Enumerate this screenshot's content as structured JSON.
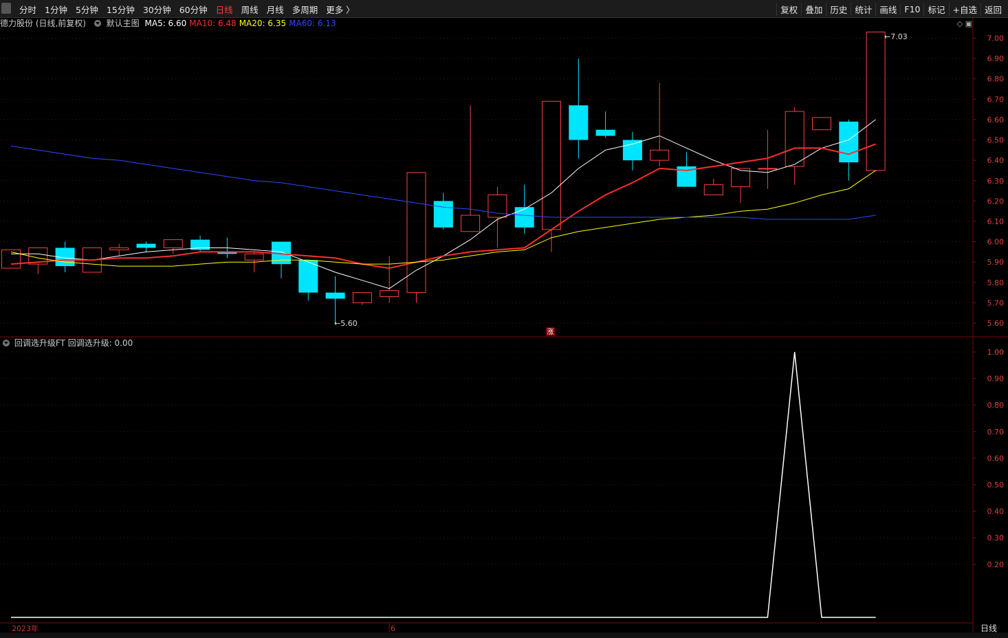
{
  "toolbar": {
    "periods": [
      "分时",
      "1分钟",
      "5分钟",
      "15分钟",
      "30分钟",
      "60分钟",
      "日线",
      "周线",
      "月线",
      "多周期",
      "更多 〉"
    ],
    "active_period": "日线",
    "right_tools": [
      "复权",
      "叠加",
      "历史",
      "统计",
      "画线",
      "F10",
      "标记",
      "+自选",
      "返回"
    ]
  },
  "main_panel": {
    "stock_label": "德力股份 (日线,前复权)",
    "template": "默认主图",
    "ma_labels": [
      {
        "text": "MA5: 6.60",
        "color": "#ffffff"
      },
      {
        "text": "MA10: 6.48",
        "color": "#ff2d2d"
      },
      {
        "text": "MA20: 6.35",
        "color": "#ffff00"
      },
      {
        "text": "MA60: 6.13",
        "color": "#2b4bff"
      }
    ],
    "high_marker": "7.03",
    "low_marker": "5.60",
    "zhang_icon": "涨"
  },
  "indicator_panel": {
    "title": "回调选升级FT",
    "value_label": "回调选升级: 0.00"
  },
  "time_axis": {
    "year_label": "2023年",
    "month_label": "6",
    "period_label": "日线"
  },
  "chart_data": [
    {
      "type": "candlestick",
      "title": "德力股份 (日线,前复权)",
      "ylim": [
        5.55,
        7.05
      ],
      "y_ticks": [
        "7.00",
        "6.90",
        "6.80",
        "6.70",
        "6.60",
        "6.50",
        "6.40",
        "6.30",
        "6.20",
        "6.10",
        "6.00",
        "5.90",
        "5.80",
        "5.70",
        "5.60"
      ],
      "candles": [
        {
          "o": 5.87,
          "h": 5.96,
          "l": 5.87,
          "c": 5.96
        },
        {
          "o": 5.89,
          "h": 5.97,
          "l": 5.84,
          "c": 5.97
        },
        {
          "o": 5.97,
          "h": 6.0,
          "l": 5.85,
          "c": 5.88
        },
        {
          "o": 5.85,
          "h": 5.97,
          "l": 5.85,
          "c": 5.97
        },
        {
          "o": 5.96,
          "h": 5.99,
          "l": 5.93,
          "c": 5.97
        },
        {
          "o": 5.99,
          "h": 6.0,
          "l": 5.95,
          "c": 5.97
        },
        {
          "o": 5.97,
          "h": 6.01,
          "l": 5.94,
          "c": 6.01
        },
        {
          "o": 6.01,
          "h": 6.03,
          "l": 5.95,
          "c": 5.96
        },
        {
          "o": 5.95,
          "h": 6.02,
          "l": 5.92,
          "c": 5.94
        },
        {
          "o": 5.91,
          "h": 5.95,
          "l": 5.85,
          "c": 5.94
        },
        {
          "o": 6.0,
          "h": 6.0,
          "l": 5.82,
          "c": 5.89
        },
        {
          "o": 5.91,
          "h": 5.91,
          "l": 5.71,
          "c": 5.75
        },
        {
          "o": 5.75,
          "h": 5.83,
          "l": 5.6,
          "c": 5.72
        },
        {
          "o": 5.7,
          "h": 5.75,
          "l": 5.69,
          "c": 5.75
        },
        {
          "o": 5.73,
          "h": 5.93,
          "l": 5.7,
          "c": 5.76
        },
        {
          "o": 5.75,
          "h": 6.34,
          "l": 5.7,
          "c": 6.34
        },
        {
          "o": 6.2,
          "h": 6.24,
          "l": 6.06,
          "c": 6.07
        },
        {
          "o": 6.05,
          "h": 6.67,
          "l": 6.05,
          "c": 6.13
        },
        {
          "o": 6.12,
          "h": 6.27,
          "l": 5.97,
          "c": 6.23
        },
        {
          "o": 6.17,
          "h": 6.28,
          "l": 6.04,
          "c": 6.07
        },
        {
          "o": 6.06,
          "h": 6.69,
          "l": 5.95,
          "c": 6.69
        },
        {
          "o": 6.67,
          "h": 6.9,
          "l": 6.41,
          "c": 6.5
        },
        {
          "o": 6.55,
          "h": 6.64,
          "l": 6.51,
          "c": 6.52
        },
        {
          "o": 6.5,
          "h": 6.54,
          "l": 6.35,
          "c": 6.4
        },
        {
          "o": 6.4,
          "h": 6.78,
          "l": 6.37,
          "c": 6.45
        },
        {
          "o": 6.37,
          "h": 6.44,
          "l": 6.27,
          "c": 6.27
        },
        {
          "o": 6.23,
          "h": 6.31,
          "l": 6.23,
          "c": 6.28
        },
        {
          "o": 6.27,
          "h": 6.36,
          "l": 6.19,
          "c": 6.36
        },
        {
          "o": 6.36,
          "h": 6.55,
          "l": 6.26,
          "c": 6.36
        },
        {
          "o": 6.37,
          "h": 6.66,
          "l": 6.28,
          "c": 6.64
        },
        {
          "o": 6.55,
          "h": 6.61,
          "l": 6.55,
          "c": 6.61
        },
        {
          "o": 6.59,
          "h": 6.6,
          "l": 6.3,
          "c": 6.39
        },
        {
          "o": 6.35,
          "h": 7.03,
          "l": 6.35,
          "c": 7.03
        }
      ],
      "series": [
        {
          "name": "MA5",
          "color": "#ffffff",
          "values": [
            5.94,
            5.94,
            5.92,
            5.91,
            5.93,
            5.95,
            5.96,
            5.97,
            5.97,
            5.96,
            5.95,
            5.9,
            5.85,
            5.81,
            5.77,
            5.86,
            5.93,
            6.01,
            6.11,
            6.16,
            6.24,
            6.36,
            6.45,
            6.48,
            6.52,
            6.46,
            6.4,
            6.35,
            6.34,
            6.38,
            6.46,
            6.5,
            6.6
          ]
        },
        {
          "name": "MA10",
          "color": "#ff2d2d",
          "values": [
            5.89,
            5.9,
            5.91,
            5.91,
            5.92,
            5.92,
            5.93,
            5.95,
            5.95,
            5.95,
            5.94,
            5.93,
            5.92,
            5.89,
            5.87,
            5.9,
            5.93,
            5.95,
            5.96,
            5.97,
            6.06,
            6.15,
            6.23,
            6.29,
            6.36,
            6.35,
            6.37,
            6.39,
            6.41,
            6.46,
            6.46,
            6.43,
            6.48
          ]
        },
        {
          "name": "MA20",
          "color": "#ffff00",
          "values": [
            5.95,
            5.92,
            5.9,
            5.89,
            5.88,
            5.88,
            5.88,
            5.89,
            5.9,
            5.9,
            5.91,
            5.91,
            5.9,
            5.89,
            5.89,
            5.9,
            5.91,
            5.93,
            5.95,
            5.96,
            6.02,
            6.05,
            6.07,
            6.09,
            6.11,
            6.12,
            6.13,
            6.15,
            6.16,
            6.19,
            6.23,
            6.26,
            6.35
          ]
        },
        {
          "name": "MA60",
          "color": "#2b4bff",
          "values": [
            6.47,
            6.45,
            6.43,
            6.41,
            6.4,
            6.38,
            6.36,
            6.34,
            6.32,
            6.3,
            6.29,
            6.27,
            6.25,
            6.23,
            6.21,
            6.19,
            6.17,
            6.16,
            6.14,
            6.13,
            6.12,
            6.12,
            6.12,
            6.12,
            6.12,
            6.12,
            6.12,
            6.12,
            6.11,
            6.11,
            6.11,
            6.11,
            6.13
          ]
        }
      ]
    },
    {
      "type": "line",
      "title": "回调选升级FT",
      "ylim": [
        0,
        1.05
      ],
      "y_ticks": [
        "1.00",
        "0.90",
        "0.80",
        "0.70",
        "0.60",
        "0.50",
        "0.40",
        "0.30",
        "0.20"
      ],
      "series": [
        {
          "name": "回调选升级",
          "color": "#ffffff",
          "values": [
            0,
            0,
            0,
            0,
            0,
            0,
            0,
            0,
            0,
            0,
            0,
            0,
            0,
            0,
            0,
            0,
            0,
            0,
            0,
            0,
            0,
            0,
            0,
            0,
            0,
            0,
            0,
            0,
            0,
            1,
            0,
            0,
            0
          ]
        }
      ]
    }
  ]
}
